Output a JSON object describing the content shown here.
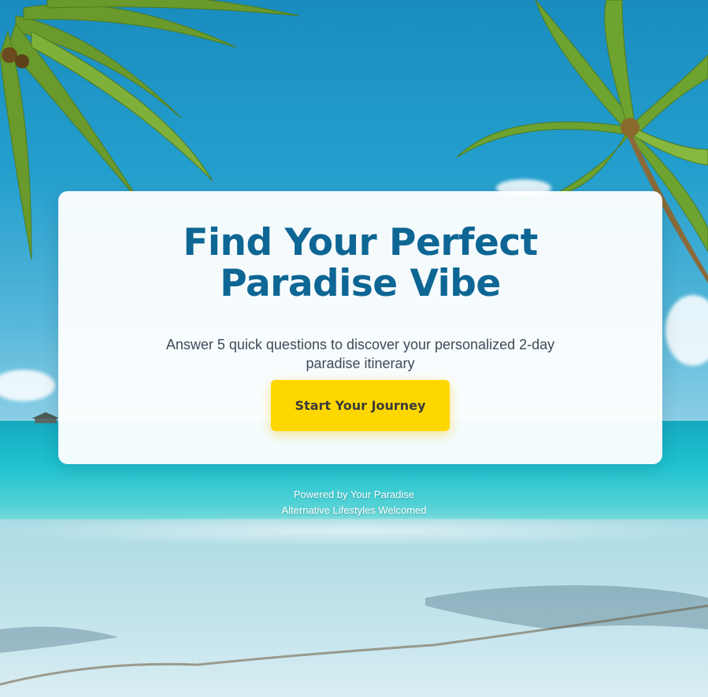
{
  "hero": {
    "title": "Find Your Perfect Paradise Vibe",
    "subtitle": "Answer 5 quick questions to discover your personalized 2-day paradise itinerary",
    "cta_label": "Start Your Journey"
  },
  "footer": {
    "line1": "Powered by Your Paradise",
    "line2": "Alternative Lifestyles Welcomed"
  },
  "colors": {
    "title": "#0d6694",
    "cta_background": "#ffd700",
    "cta_text": "#3a3a3a",
    "subtitle": "#3d4a58"
  },
  "background": {
    "scene": "tropical-beach-with-palm-trees"
  }
}
